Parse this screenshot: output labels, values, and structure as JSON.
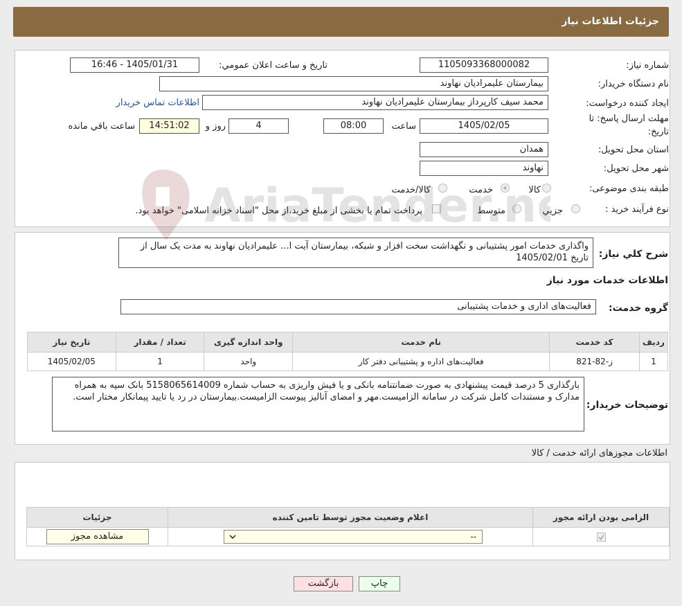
{
  "header": {
    "title": "جزئیات اطلاعات نیاز"
  },
  "form": {
    "need_number_label": "شماره نیاز:",
    "need_number": "1105093368000082",
    "announce_label": "تاریخ و ساعت اعلان عمومي:",
    "announce_value": "1405/01/31 - 16:46",
    "buyer_org_label": "نام دستگاه خريدار:",
    "buyer_org": "بیمارستان علیمرادیان نهاوند",
    "creator_label": "ايجاد کننده درخواست:",
    "creator": "محمد سیف کارپرداز بیمارستان علیمرادیان نهاوند",
    "contact_link": "اطلاعات تماس خريدار",
    "deadline_label_1": "مهلت ارسال پاسخ: تا",
    "deadline_label_2": "تاريخ:",
    "deadline_date": "1405/02/05",
    "time_label": "ساعت",
    "deadline_time": "08:00",
    "days": "4",
    "days_label": "روز و",
    "remaining_time": "14:51:02",
    "remaining_label": "ساعت باقي مانده",
    "province_label": "استان محل تحويل:",
    "province": "همدان",
    "city_label": "شهر محل تحويل:",
    "city": "نهاوند",
    "category_label": "طبقه بندی موضوعی:",
    "category_options": [
      "کالا",
      "خدمت",
      "کالا/خدمت"
    ],
    "purchase_label": "نوع فرآيند خريد :",
    "purchase_options": [
      "جزيي",
      "متوسط"
    ],
    "purchase_note": "پرداخت تمام یا بخشی از مبلغ خرید،از محل \"اسناد خزانه اسلامی\" خواهد بود."
  },
  "need": {
    "desc_label": "شرح کلي نياز:",
    "desc_text": "واگذاری خدمات امور پشتیبانی و نگهداشت سخت افزار و شبکه، بیمارستان آیت ا... علیمرادیان نهاوند به مدت یک سال از تاریخ 1405/02/01",
    "services_title": "اطلاعات خدمات مورد نياز",
    "group_label": "گروه خدمت:",
    "group_value": "فعالیت‌های اداری و خدمات پشتیبانی",
    "table_headers": [
      "رديف",
      "کد خدمت",
      "نام خدمت",
      "واحد اندازه گيری",
      "تعداد / مقدار",
      "تاريخ نياز"
    ],
    "table_rows": [
      [
        "1",
        "ز-82-821",
        "فعالیت‌های اداره و پشتیبانی دفتر کار",
        "واحد",
        "1",
        "1405/02/05"
      ]
    ],
    "buyer_notes_label": "توضيحات خريدار:",
    "buyer_notes": "بارگذاری 5 درصد قیمت پیشنهادی به صورت ضمانتنامه بانکی و یا فیش واریزی به حساب شماره 5158065614009 بانک سپه به همراه مدارک و مستندات کامل شرکت در سامانه الزامیست.مهر و امضای آنالیز پیوست الزامیست.بیمارستان در رد یا تایید پیمانکار مختار است."
  },
  "permits": {
    "title": "اطلاعات مجوزهای ارائه خدمت / کالا",
    "headers": [
      "الزامی بودن ارائه مجوز",
      "اعلام وضعیت مجوز توسط تامین کننده",
      "جزئیات"
    ],
    "select_value": "--",
    "view_button": "مشاهده مجوز"
  },
  "buttons": {
    "print": "چاپ",
    "back": "بازگشت"
  },
  "watermark": {
    "text": "AriaTender.net"
  },
  "colors": {
    "header_bg": "#8a6b41",
    "link": "#1a55b8",
    "back_btn": "#fde0e0",
    "print_btn": "#eaffea"
  }
}
